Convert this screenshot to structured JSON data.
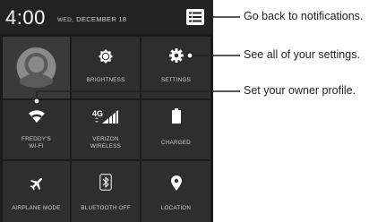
{
  "status": {
    "time": "4:00",
    "date_dow": "WED,",
    "date": "DECEMBER 18"
  },
  "tiles": {
    "brightness": "BRIGHTNESS",
    "settings": "SETTINGS",
    "wifi": "FREDDY'S\nWI-FI",
    "verizon": "VERIZON\nWIRELESS",
    "charged": "CHARGED",
    "airplane": "AIRPLANE MODE",
    "bluetooth": "BLUETOOTH OFF",
    "location": "LOCATION",
    "network_badge": "4G"
  },
  "callouts": {
    "notifications": "Go back to notifications.",
    "settings": "See all of your settings.",
    "profile": "Set your owner profile."
  },
  "icons": [
    "menu-icon",
    "avatar-icon",
    "brightness-icon",
    "gear-icon",
    "wifi-icon",
    "signal-icon",
    "battery-icon",
    "airplane-icon",
    "bluetooth-icon",
    "location-pin-icon"
  ],
  "colors": {
    "panel": "#1b1b1b",
    "tile": "#2e2e2e",
    "icon": "#ffffff",
    "label": "#cfcfcf",
    "callout_line": "#222222"
  }
}
